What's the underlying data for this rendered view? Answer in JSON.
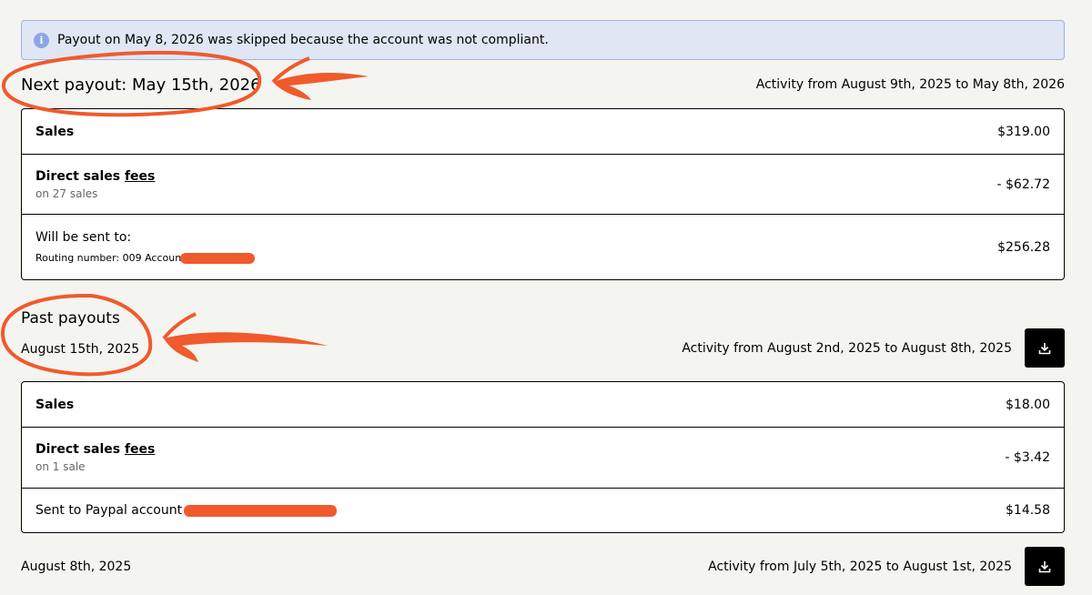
{
  "alert": {
    "icon": "info-icon",
    "text": "Payout on May 8, 2026 was skipped because the account was not compliant."
  },
  "next_payout": {
    "title": "Next payout: May 15th, 2026",
    "activity": "Activity from August 9th, 2025 to May 8th, 2026",
    "rows": {
      "sales_label": "Sales",
      "sales_amount": "$319.00",
      "fees_label": "Direct sales",
      "fees_link": "fees",
      "fees_sub": "on 27 sales",
      "fees_amount": "- $62.72",
      "sent_label": "Will be sent to:",
      "sent_detail": "Routing number: 009 Account",
      "sent_amount": "$256.28"
    }
  },
  "past_payouts": {
    "title": "Past payouts",
    "items": [
      {
        "date": "August 15th, 2025",
        "activity": "Activity from August 2nd, 2025 to August 8th, 2025",
        "sales_label": "Sales",
        "sales_amount": "$18.00",
        "fees_label": "Direct sales",
        "fees_link": "fees",
        "fees_sub": "on 1 sale",
        "fees_amount": "- $3.42",
        "sent_label": "Sent to Paypal account",
        "sent_amount": "$14.58"
      },
      {
        "date": "August 8th, 2025",
        "activity": "Activity from July 5th, 2025 to August 1st, 2025"
      }
    ]
  },
  "icons": {
    "download": "download-icon"
  },
  "colors": {
    "annotation": "#f05a2c",
    "alert_bg": "#e0e6f3",
    "alert_border": "#9fb4e4"
  }
}
